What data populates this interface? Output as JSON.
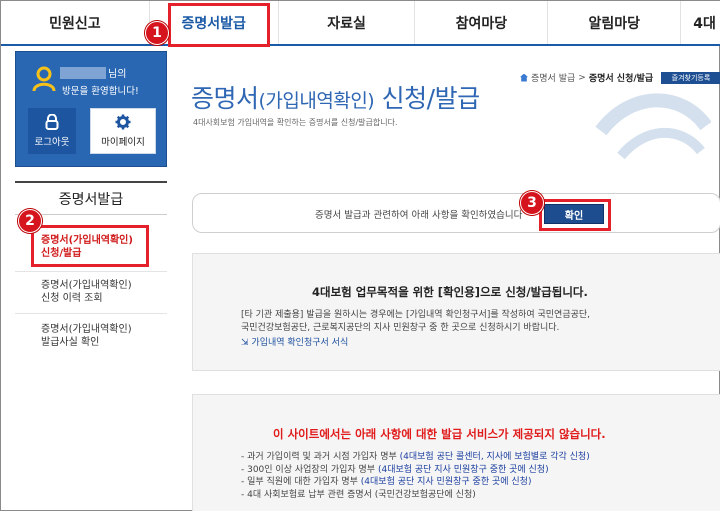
{
  "topnav": {
    "tabs": [
      {
        "label": "민원신고"
      },
      {
        "label": "증명서발급"
      },
      {
        "label": "자료실"
      },
      {
        "label": "참여마당"
      },
      {
        "label": "알림마당"
      },
      {
        "label": "4대"
      }
    ]
  },
  "markers": [
    "1",
    "2",
    "3"
  ],
  "userbox": {
    "name_suffix": "님의",
    "welcome": "방문을 환영합니다!",
    "logout_label": "로그아웃",
    "mypage_label": "마이페이지"
  },
  "sidebar": {
    "title": "증명서발급",
    "items": [
      {
        "line1": "증명서(가입내역확인)",
        "line2": "신청/발급"
      },
      {
        "line1": "증명서(가입내역확인)",
        "line2": "신청 이력 조회"
      },
      {
        "line1": "증명서(가입내역확인)",
        "line2": "발급사실 확인"
      }
    ]
  },
  "breadcrumb": {
    "parent": "증명서 발급",
    "sep": ">",
    "current": "증명서 신청/발급",
    "favorite": "즐겨찾기등록"
  },
  "page": {
    "title_a": "증명서",
    "title_b": "(가입내역확인)",
    "title_c": " 신청/발급",
    "subtitle": "4대사회보험 가입내역을 확인하는 증명서를 신청/발급합니다."
  },
  "confirm": {
    "text": "증명서 발급과 관련하여 아래 사항을 확인하였습니다",
    "button": "확인"
  },
  "notice1": {
    "title": "4대보험 업무목적을 위한 [확인용]으로 신청/발급됩니다.",
    "line1": "[타 기관 제출용] 발급을 원하시는 경우에는 [가입내역 확인청구서]를 작성하여 국민연금공단,",
    "line2": "국민건강보험공단, 근로복지공단의 지사 민원창구 중 한 곳으로 신청하시기 바랍니다.",
    "link": "가입내역 확인청구서 서식"
  },
  "notice2": {
    "title": "이 사이트에서는 아래 사항에 대한 발급 서비스가 제공되지 않습니다.",
    "items": [
      {
        "text": "- 과거 가입이력 및 과거 시점 가입자 명부 ",
        "hint": "(4대보험 공단 콜센터, 지사에 보험별로 각각 신청)"
      },
      {
        "text": "- 300인 이상 사업장의 가입자 명부 ",
        "hint": "(4대보험 공단 지사 민원창구 중한 곳에 신청)"
      },
      {
        "text": "- 일부 직원에 대한 가입자 명부 ",
        "hint": "(4대보험 공단 지사 민원창구 중한 곳에 신청)"
      },
      {
        "text": "- 4대 사회보험료 납부 관련 증명서 (국민건강보험공단에 신청)",
        "hint": ""
      }
    ]
  }
}
